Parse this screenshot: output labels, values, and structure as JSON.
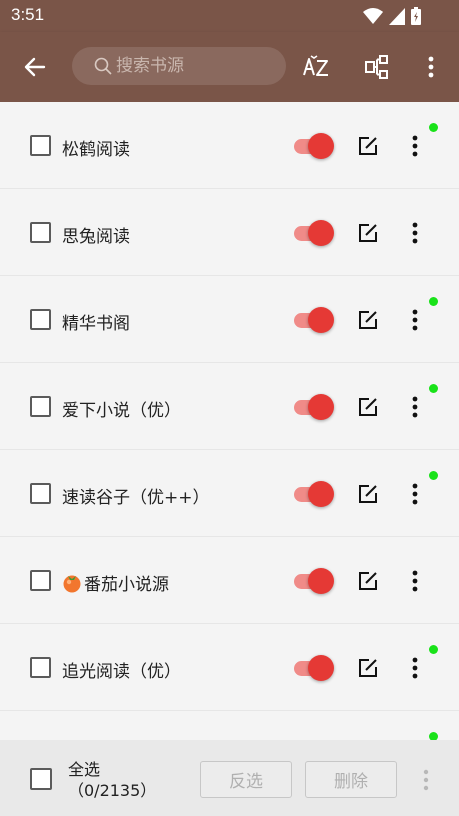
{
  "status_bar": {
    "time": "3:51"
  },
  "toolbar": {
    "search_placeholder": "搜索书源",
    "sort_icon": "sort-az-icon",
    "group_icon": "group-icon",
    "menu_icon": "more-vert-icon"
  },
  "sources": [
    {
      "name": "松鹤阅读",
      "enabled": true,
      "has_dot": true
    },
    {
      "name": "思兔阅读",
      "enabled": true,
      "has_dot": false
    },
    {
      "name": "精华书阁",
      "enabled": true,
      "has_dot": true
    },
    {
      "name": "爱下小说（优）",
      "enabled": true,
      "has_dot": true
    },
    {
      "name": "速读谷子（优++）",
      "enabled": true,
      "has_dot": true
    },
    {
      "name": "番茄小说源",
      "enabled": true,
      "has_dot": false,
      "emoji": "tomato-icon"
    },
    {
      "name": "追光阅读（优）",
      "enabled": true,
      "has_dot": true
    }
  ],
  "bottom_bar": {
    "select_all_label": "全选",
    "count": "（0/2135）",
    "invert_label": "反选",
    "delete_label": "删除"
  },
  "colors": {
    "toolbar": "#7a5548",
    "switch_thumb": "#e53935",
    "switch_track": "#f08b88",
    "status_dot": "#19e219"
  }
}
